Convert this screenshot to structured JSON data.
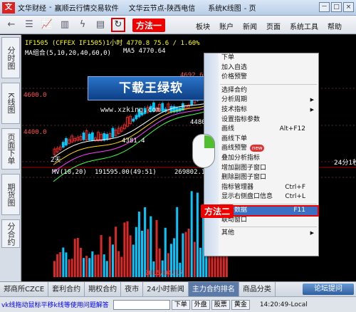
{
  "titlebar": {
    "logo_text": "文",
    "app_name": "文华财经",
    "separator": "-",
    "tagline": "赢顺云行情交易软件",
    "server": "文华云节点-陕西电信",
    "chart_title": "系统K线图",
    "page_label": "- 页",
    "buttons": [
      "－",
      "□",
      "×"
    ]
  },
  "toolbar": {
    "icons": [
      "arrow-left-icon",
      "menu-icon",
      "chart-icon",
      "ledger-icon",
      "lightning-icon",
      "disk-icon",
      "refresh-icon"
    ],
    "callout_1": "方法一"
  },
  "top_menu": [
    "板块",
    "账户",
    "新闻",
    "页面",
    "系统工具",
    "帮助"
  ],
  "left_tabs": [
    "分时图",
    "K线图",
    "页面下单",
    "期货图",
    "分合约"
  ],
  "chart": {
    "info_line": "IF1505  (CFFEX IF1505)1小时   4770.8    75.6 / 1.60%",
    "ma_label": "MA组合(5,10,20,40,60,0)",
    "ma5_label": "MA5 4770.64",
    "price_labels": [
      "4600.0",
      "4400.0"
    ],
    "annot_4692": "4692.6",
    "annot_4381": "4381.4",
    "annot_4480": "4480",
    "tag_2day": "2天",
    "mv_label": "MV(10,20)",
    "mv_value": "191595.00(49:51)",
    "mv_value2": "269802.1",
    "date_label": "2015/04/17",
    "right_tag": "24分1秒",
    "banner": "下载王绿软",
    "watermark": "www.xzking.com",
    "callout_2": "方法二"
  },
  "context_menu": {
    "items": [
      {
        "label": "下单"
      },
      {
        "label": "加入自选"
      },
      {
        "label": "价格预警"
      },
      {
        "sep": true
      },
      {
        "label": "选择合约"
      },
      {
        "label": "分析周期",
        "arrow": true
      },
      {
        "label": "技术指标",
        "arrow": true
      },
      {
        "label": "设置指标参数"
      },
      {
        "label": "画线",
        "shortcut": "Alt+F12"
      },
      {
        "label": "画线下单"
      },
      {
        "label": "画线预警",
        "badge": "new"
      },
      {
        "label": "叠加分析指标"
      },
      {
        "label": "增加副图子窗口"
      },
      {
        "label": "删除副图子窗口"
      },
      {
        "label": "指标管理器",
        "shortcut": "Ctrl+F"
      },
      {
        "label": "显示右侧盘口信息",
        "shortcut": "Ctrl+L"
      },
      {
        "sep": true
      },
      {
        "label": "重传数据",
        "shortcut": "F11",
        "selected": true
      },
      {
        "label": "联动窗口"
      },
      {
        "sep": true
      },
      {
        "label": "其他",
        "arrow": true
      }
    ]
  },
  "bottom_tabs": [
    "郑商所CZCE",
    "套利合约",
    "期权合约",
    "夜市",
    "24小时新闻",
    "主力合约排名",
    "商品分类"
  ],
  "forum_button": "论坛提问",
  "statusbar": {
    "message": "vk线拖动鼠标平移k线等使用问题解答",
    "buttons": [
      "下单",
      "外盘",
      "股票",
      "黄金"
    ],
    "clock": "14:20:49-Local"
  },
  "colors": {
    "background": "#000000",
    "up": "#ff3030",
    "down": "#00c8ff",
    "ma5": "#ffffff",
    "ma10": "#ffd700",
    "ma20": "#ff40ff",
    "ma40": "#40ff40"
  }
}
